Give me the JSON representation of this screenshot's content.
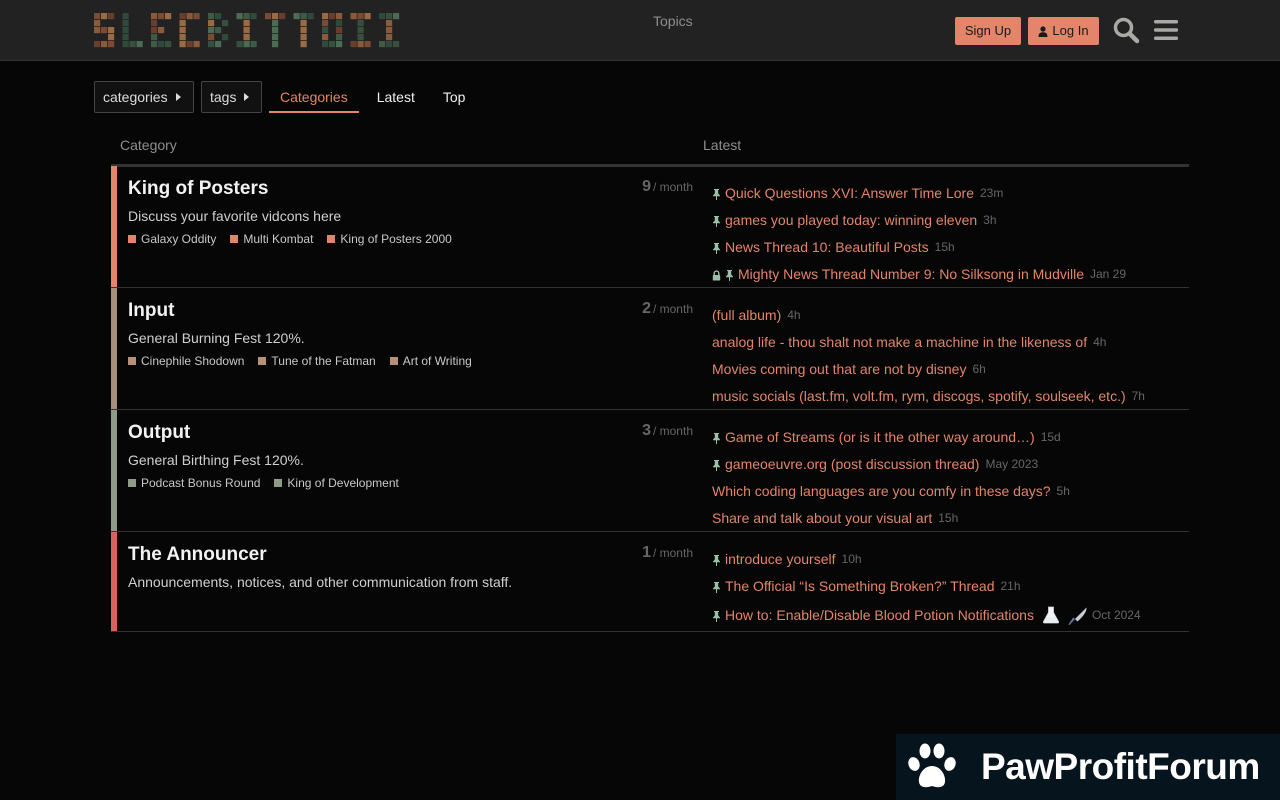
{
  "header": {
    "logo_text": "SLECBITTOIN",
    "signup_label": "Sign Up",
    "login_label": "Log In",
    "accent": "#e2856a"
  },
  "nav": {
    "categories_dropdown": "categories",
    "tags_dropdown": "tags",
    "tabs": [
      "Categories",
      "Latest",
      "Top"
    ],
    "active_tab": "Categories"
  },
  "table": {
    "col_category": "Category",
    "col_topics": "Topics",
    "col_latest": "Latest"
  },
  "rows": [
    {
      "title": "King of Posters",
      "description": "Discuss your favorite vidcons here",
      "color": "#e2856a",
      "count": "9",
      "per": "/ month",
      "subcategories": [
        {
          "name": "Galaxy Oddity",
          "color": "#e2856a"
        },
        {
          "name": "Multi Kombat",
          "color": "#e2856a"
        },
        {
          "name": "King of Posters 2000",
          "color": "#e2856a"
        }
      ],
      "topics": [
        {
          "title": "Quick Questions XVI: Answer Time Lore",
          "age": "23m",
          "pinned": true,
          "locked": false
        },
        {
          "title": "games you played today: winning eleven",
          "age": "3h",
          "pinned": true,
          "locked": false
        },
        {
          "title": "News Thread 10: Beautiful Posts",
          "age": "15h",
          "pinned": true,
          "locked": false
        },
        {
          "title": "Mighty News Thread Number 9: No Silksong in Mudville",
          "age": "Jan 29",
          "pinned": true,
          "locked": true
        }
      ]
    },
    {
      "title": "Input",
      "description": "General Burning Fest 120%.",
      "color": "#a88f7a",
      "count": "2",
      "per": "/ month",
      "subcategories": [
        {
          "name": "Cinephile Shodown",
          "color": "#b8907a"
        },
        {
          "name": "Tune of the Fatman",
          "color": "#b8907a"
        },
        {
          "name": "Art of Writing",
          "color": "#b8907a"
        }
      ],
      "topics": [
        {
          "title": "(full album)",
          "age": "4h",
          "pinned": false,
          "locked": false
        },
        {
          "title": "analog life - thou shalt not make a machine in the likeness of",
          "age": "4h",
          "pinned": false,
          "locked": false
        },
        {
          "title": "Movies coming out that are not by disney",
          "age": "6h",
          "pinned": false,
          "locked": false
        },
        {
          "title": "music socials (last.fm, volt.fm, rym, discogs, spotify, soulseek, etc.)",
          "age": "7h",
          "pinned": false,
          "locked": false
        }
      ]
    },
    {
      "title": "Output",
      "description": "General Birthing Fest 120%.",
      "color": "#8f9a87",
      "count": "3",
      "per": "/ month",
      "subcategories": [
        {
          "name": "Podcast Bonus Round",
          "color": "#8f9a87"
        },
        {
          "name": "King of Development",
          "color": "#8f9a87"
        }
      ],
      "topics": [
        {
          "title": "Game of Streams (or is it the other way around…)",
          "age": "15d",
          "pinned": true,
          "locked": false
        },
        {
          "title": "gameoeuvre.org (post discussion thread)",
          "age": "May 2023",
          "pinned": true,
          "locked": false
        },
        {
          "title": "Which coding languages are you comfy in these days?",
          "age": "5h",
          "pinned": false,
          "locked": false
        },
        {
          "title": "Share and talk about your visual art",
          "age": "15h",
          "pinned": false,
          "locked": false
        }
      ]
    },
    {
      "title": "The Announcer",
      "description": "Announcements, notices, and other communication from staff.",
      "color": "#d9625c",
      "count": "1",
      "per": "/ month",
      "subcategories": [],
      "topics": [
        {
          "title": "introduce yourself",
          "age": "10h",
          "pinned": true,
          "locked": false
        },
        {
          "title": "The Official “Is Something Broken?” Thread",
          "age": "21h",
          "pinned": true,
          "locked": false
        },
        {
          "title": "How to: Enable/Disable Blood Potion Notifications",
          "age": "Oct 2024",
          "pinned": true,
          "locked": false,
          "emojis": [
            "flask-emoji",
            "knife-emoji"
          ]
        }
      ]
    }
  ],
  "watermark": {
    "text": "PawProfitForum"
  }
}
